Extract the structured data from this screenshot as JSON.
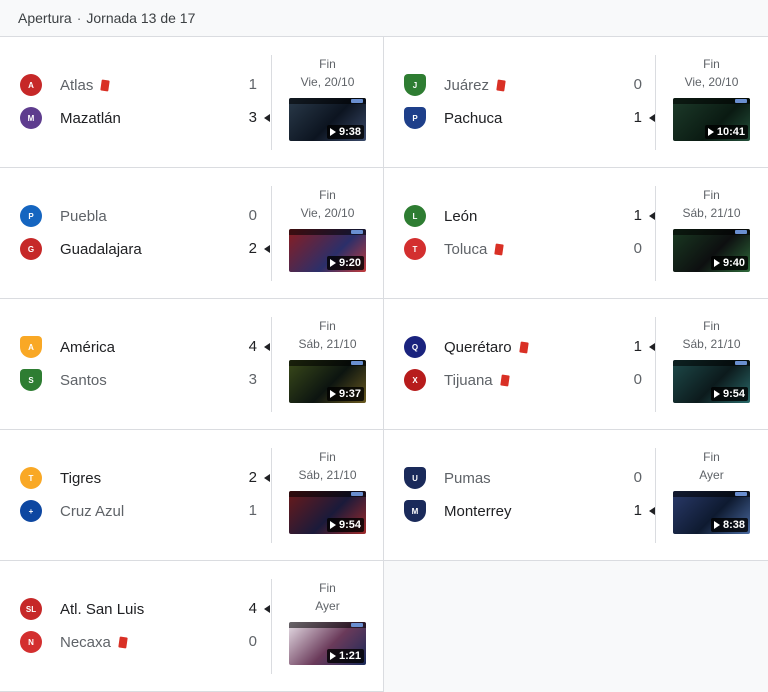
{
  "header": {
    "competition": "Apertura",
    "separator": "·",
    "round": "Jornada 13 de 17"
  },
  "colors": {
    "red_card": "#d93025",
    "divider": "#dadce0",
    "muted_text": "#5f6368"
  },
  "matches": [
    {
      "status": "Fin",
      "date": "Vie, 20/10",
      "video_duration": "9:38",
      "home": {
        "name": "Atlas",
        "score": "1",
        "red_card": true,
        "logo_icon": "atlas-crest-icon",
        "logo_color": "#c62828",
        "logo_text": "A"
      },
      "away": {
        "name": "Mazatlán",
        "score": "3",
        "red_card": false,
        "logo_icon": "mazatlan-crest-icon",
        "logo_color": "#5e3c8e",
        "logo_text": "M"
      }
    },
    {
      "status": "Fin",
      "date": "Vie, 20/10",
      "video_duration": "10:41",
      "home": {
        "name": "Juárez",
        "score": "0",
        "red_card": true,
        "logo_icon": "juarez-crest-icon",
        "logo_color": "#2e7d32",
        "logo_text": "J"
      },
      "away": {
        "name": "Pachuca",
        "score": "1",
        "red_card": false,
        "logo_icon": "pachuca-crest-icon",
        "logo_color": "#1e3f8a",
        "logo_text": "P"
      }
    },
    {
      "status": "Fin",
      "date": "Vie, 20/10",
      "video_duration": "9:20",
      "home": {
        "name": "Puebla",
        "score": "0",
        "red_card": false,
        "logo_icon": "puebla-crest-icon",
        "logo_color": "#1565c0",
        "logo_text": "P"
      },
      "away": {
        "name": "Guadalajara",
        "score": "2",
        "red_card": false,
        "logo_icon": "guadalajara-crest-icon",
        "logo_color": "#c62828",
        "logo_text": "G"
      }
    },
    {
      "status": "Fin",
      "date": "Sáb, 21/10",
      "video_duration": "9:40",
      "home": {
        "name": "León",
        "score": "1",
        "red_card": false,
        "logo_icon": "leon-crest-icon",
        "logo_color": "#2e7d32",
        "logo_text": "L"
      },
      "away": {
        "name": "Toluca",
        "score": "0",
        "red_card": true,
        "logo_icon": "toluca-crest-icon",
        "logo_color": "#d32f2f",
        "logo_text": "T"
      }
    },
    {
      "status": "Fin",
      "date": "Sáb, 21/10",
      "video_duration": "9:37",
      "home": {
        "name": "América",
        "score": "4",
        "red_card": false,
        "logo_icon": "america-crest-icon",
        "logo_color": "#f9a825",
        "logo_text": "A"
      },
      "away": {
        "name": "Santos",
        "score": "3",
        "red_card": false,
        "logo_icon": "santos-crest-icon",
        "logo_color": "#2e7d32",
        "logo_text": "S"
      }
    },
    {
      "status": "Fin",
      "date": "Sáb, 21/10",
      "video_duration": "9:54",
      "home": {
        "name": "Querétaro",
        "score": "1",
        "red_card": true,
        "logo_icon": "queretaro-crest-icon",
        "logo_color": "#1a237e",
        "logo_text": "Q"
      },
      "away": {
        "name": "Tijuana",
        "score": "0",
        "red_card": true,
        "logo_icon": "tijuana-crest-icon",
        "logo_color": "#b71c1c",
        "logo_text": "X"
      }
    },
    {
      "status": "Fin",
      "date": "Sáb, 21/10",
      "video_duration": "9:54",
      "home": {
        "name": "Tigres",
        "score": "2",
        "red_card": false,
        "logo_icon": "tigres-crest-icon",
        "logo_color": "#f9a825",
        "logo_text": "T"
      },
      "away": {
        "name": "Cruz Azul",
        "score": "1",
        "red_card": false,
        "logo_icon": "cruz-azul-crest-icon",
        "logo_color": "#0d47a1",
        "logo_text": "+"
      }
    },
    {
      "status": "Fin",
      "date": "Ayer",
      "video_duration": "8:38",
      "home": {
        "name": "Pumas",
        "score": "0",
        "red_card": false,
        "logo_icon": "pumas-crest-icon",
        "logo_color": "#1a2a5a",
        "logo_text": "U"
      },
      "away": {
        "name": "Monterrey",
        "score": "1",
        "red_card": false,
        "logo_icon": "monterrey-crest-icon",
        "logo_color": "#1a2a5a",
        "logo_text": "M"
      }
    },
    {
      "status": "Fin",
      "date": "Ayer",
      "video_duration": "1:21",
      "home": {
        "name": "Atl. San Luis",
        "score": "4",
        "red_card": false,
        "logo_icon": "atletico-san-luis-crest-icon",
        "logo_color": "#c62828",
        "logo_text": "SL"
      },
      "away": {
        "name": "Necaxa",
        "score": "0",
        "red_card": true,
        "logo_icon": "necaxa-crest-icon",
        "logo_color": "#d32f2f",
        "logo_text": "N"
      }
    }
  ]
}
